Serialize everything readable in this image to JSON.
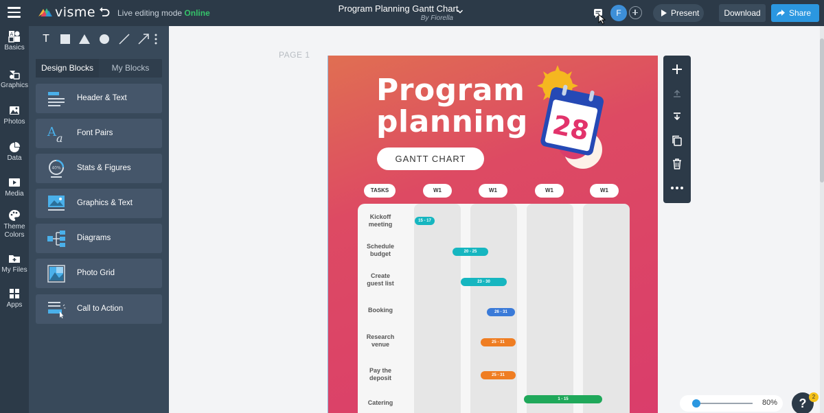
{
  "topbar": {
    "logo_text": "visme",
    "mode_label": "Live editing mode",
    "mode_status": "Online",
    "doc_title": "Program Planning Gantt Chart",
    "doc_author": "By Fiorella",
    "avatar_initial": "F",
    "present_label": "Present",
    "download_label": "Download",
    "share_label": "Share"
  },
  "rail": {
    "items": [
      {
        "label": "Basics",
        "icon": "basics-icon"
      },
      {
        "label": "Graphics",
        "icon": "graphics-icon"
      },
      {
        "label": "Photos",
        "icon": "photos-icon"
      },
      {
        "label": "Data",
        "icon": "data-icon"
      },
      {
        "label": "Media",
        "icon": "media-icon"
      },
      {
        "label": "Theme",
        "label2": "Colors",
        "icon": "palette-icon"
      },
      {
        "label": "My Files",
        "icon": "folder-icon"
      },
      {
        "label": "Apps",
        "icon": "apps-icon"
      }
    ]
  },
  "panel": {
    "tools": {
      "text_tool": "T"
    },
    "tabs": [
      {
        "label": "Design Blocks",
        "active": true
      },
      {
        "label": "My Blocks",
        "active": false
      }
    ],
    "blocks": [
      {
        "label": "Header & Text",
        "icon": "header-text-icon"
      },
      {
        "label": "Font Pairs",
        "icon": "font-pairs-icon",
        "glyph": "A",
        "glyph2": "a"
      },
      {
        "label": "Stats & Figures",
        "icon": "stats-icon",
        "glyph": "40%"
      },
      {
        "label": "Graphics & Text",
        "icon": "graphics-text-icon"
      },
      {
        "label": "Diagrams",
        "icon": "diagrams-icon"
      },
      {
        "label": "Photo Grid",
        "icon": "photo-grid-icon"
      },
      {
        "label": "Call to Action",
        "icon": "call-to-action-icon"
      }
    ]
  },
  "canvas": {
    "page_label": "PAGE 1",
    "zoom": "80%",
    "help_label": "?",
    "help_badge": "2"
  },
  "design": {
    "title_line1": "Program",
    "title_line2": "planning",
    "pill": "GANTT CHART",
    "calendar_day": "28",
    "colors": {
      "teal": "#16b6c0",
      "blue": "#3a7ad8",
      "orange": "#ef7d22",
      "green": "#1fa85a"
    }
  },
  "chart_data": {
    "type": "table",
    "columns": [
      "TASKS",
      "W1",
      "W1",
      "W1",
      "W1"
    ],
    "rows": [
      {
        "task": [
          "Kickoff",
          "meeting"
        ],
        "range": "15 - 17",
        "color": "#16b6c0"
      },
      {
        "task": [
          "Schedule",
          "budget"
        ],
        "range": "20 - 25",
        "color": "#16b6c0"
      },
      {
        "task": [
          "Create",
          "guest list"
        ],
        "range": "23 - 30",
        "color": "#16b6c0"
      },
      {
        "task": [
          "Booking"
        ],
        "range": "26 - 31",
        "color": "#3a7ad8"
      },
      {
        "task": [
          "Research",
          "venue"
        ],
        "range": "25 - 31",
        "color": "#ef7d22"
      },
      {
        "task": [
          "Pay the",
          "deposit"
        ],
        "range": "25 - 31",
        "color": "#ef7d22"
      },
      {
        "task": [
          "Catering"
        ],
        "range": "1 - 15",
        "color": "#1fa85a"
      }
    ]
  }
}
